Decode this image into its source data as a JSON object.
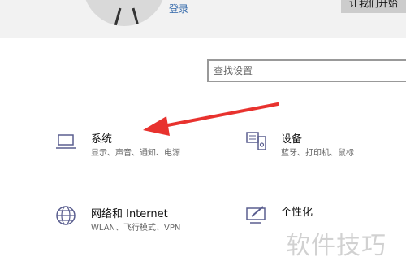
{
  "header": {
    "login_label": "登录",
    "right_button_label": "让我们开始"
  },
  "search": {
    "placeholder": "查找设置"
  },
  "tiles": [
    {
      "name": "系统",
      "desc": "显示、声音、通知、电源",
      "icon": "laptop-icon"
    },
    {
      "name": "设备",
      "desc": "蓝牙、打印机、鼠标",
      "icon": "devices-icon"
    },
    {
      "name": "网络和 Internet",
      "desc": "WLAN、飞行模式、VPN",
      "icon": "globe-icon"
    },
    {
      "name": "个性化",
      "desc": "",
      "icon": "personalization-icon"
    }
  ],
  "annotation": {
    "arrow_color": "#e8322e"
  },
  "watermark": "软件技巧",
  "colors": {
    "accent_link": "#2e65a8",
    "icon_stroke": "#5a5e8f",
    "header_bg": "#f2f2f2"
  }
}
